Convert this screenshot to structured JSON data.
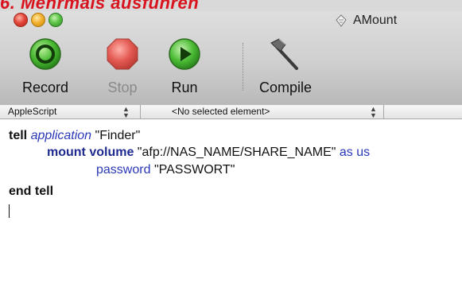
{
  "header_strip": {
    "text": "6. Mehrmals ausführen"
  },
  "window": {
    "title": "AMount"
  },
  "toolbar": {
    "record_label": "Record",
    "stop_label": "Stop",
    "run_label": "Run",
    "compile_label": "Compile"
  },
  "navbar": {
    "language": "AppleScript",
    "element": "<No selected element>"
  },
  "code": {
    "line1": {
      "kw": "tell",
      "cls": "application",
      "str": "\"Finder\""
    },
    "line2": {
      "cmd": "mount volume",
      "str": "\"afp://NAS_NAME/SHARE_NAME\"",
      "param": "as us"
    },
    "line3": {
      "param": "password",
      "str": "\"PASSWORT\""
    },
    "line4": {
      "kw": "end tell"
    }
  },
  "colors": {
    "heading": "#d8131e",
    "keyword_blue": "#2a38b8",
    "command_blue": "#1f2a8f",
    "record_green": "#3fae2a",
    "stop_red": "#e24a4a"
  }
}
